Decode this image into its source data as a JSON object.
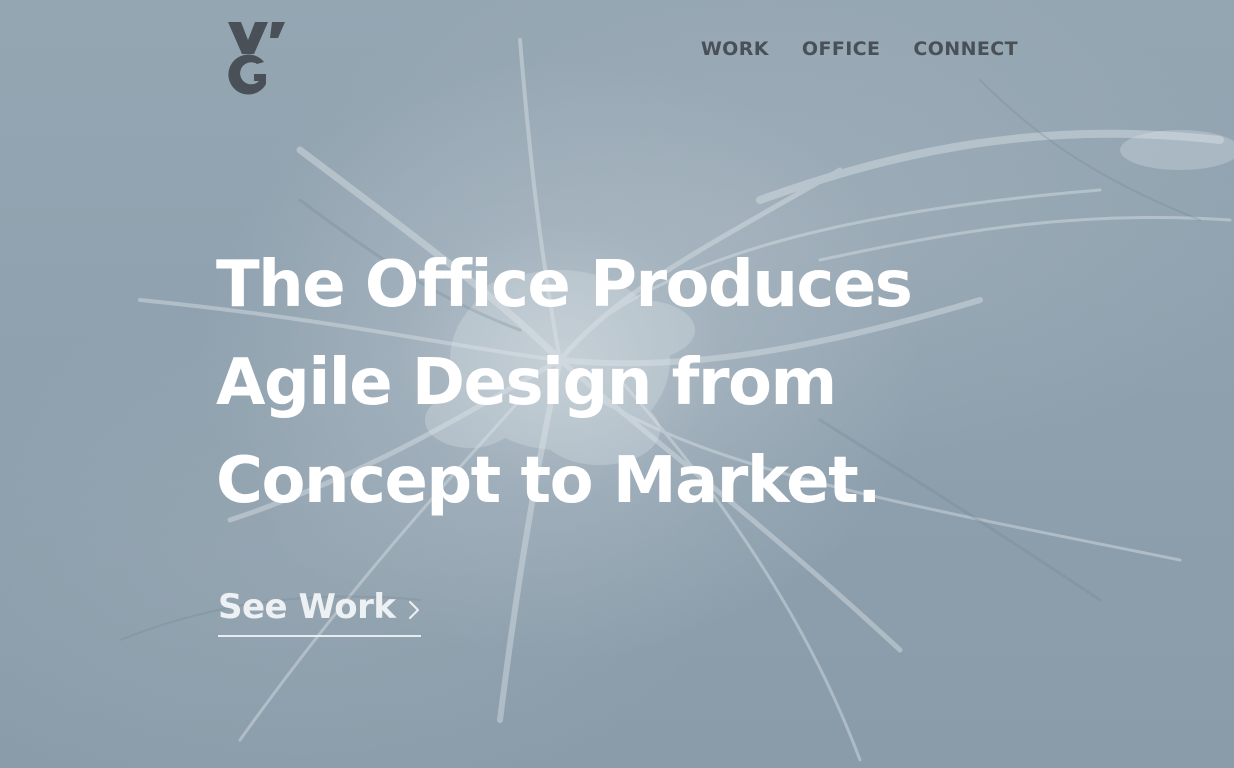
{
  "brand": {
    "logo_icon": "vg-monogram-logo",
    "logo_color": "#4a5057"
  },
  "nav": {
    "items": [
      {
        "label": "WORK"
      },
      {
        "label": "OFFICE"
      },
      {
        "label": "CONNECT"
      }
    ]
  },
  "hero": {
    "headline_lines": [
      "The Office Produces",
      "Agile Design from",
      "Concept to Market."
    ],
    "cta_label": "See Work",
    "cta_icon": "chevron-right-icon",
    "background": "aerial mountain texture"
  },
  "colors": {
    "background": "#8c9eac",
    "headline": "#ffffff",
    "nav_text": "#4a5057",
    "cta": "#eef1f3"
  }
}
